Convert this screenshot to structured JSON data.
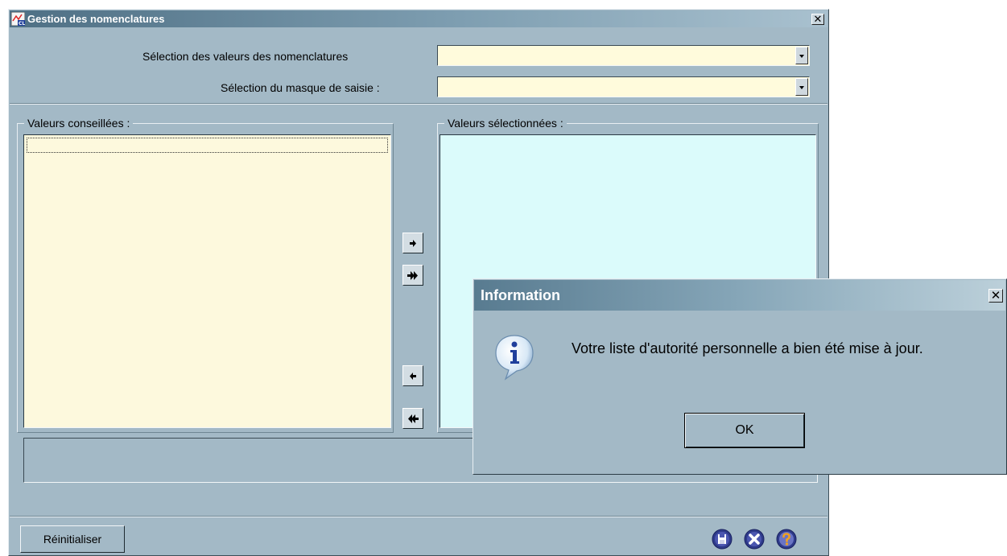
{
  "window": {
    "title": "Gestion des nomenclatures",
    "close_glyph": "✕",
    "app_icon_label": "CL"
  },
  "form": {
    "nomenclature_label": "Sélection des valeurs des nomenclatures",
    "nomenclature_value": "",
    "mask_label": "Sélection du masque de saisie :",
    "mask_value": ""
  },
  "lists": {
    "left_legend": "Valeurs conseillées :",
    "right_legend": "Valeurs sélectionnées :"
  },
  "transfer_buttons": {
    "icons": [
      "arrow-right-icon",
      "double-arrow-right-icon",
      "arrow-left-icon",
      "double-arrow-left-icon"
    ]
  },
  "footer": {
    "reset_label": "Réinitialiser",
    "icons": [
      "save-icon",
      "close-icon",
      "help-icon"
    ]
  },
  "dialog": {
    "title": "Information",
    "message": "Votre liste d'autorité personnelle a bien été mise à jour.",
    "ok_label": "OK",
    "icon": "info-icon",
    "close_glyph": "✕"
  },
  "colors": {
    "window_bg": "#a3b9c6",
    "title_bar_start": "#4e6f84",
    "left_list_bg": "#fdf9dd",
    "right_list_bg": "#dbfbfb",
    "combo_bg": "#fffbdc"
  }
}
